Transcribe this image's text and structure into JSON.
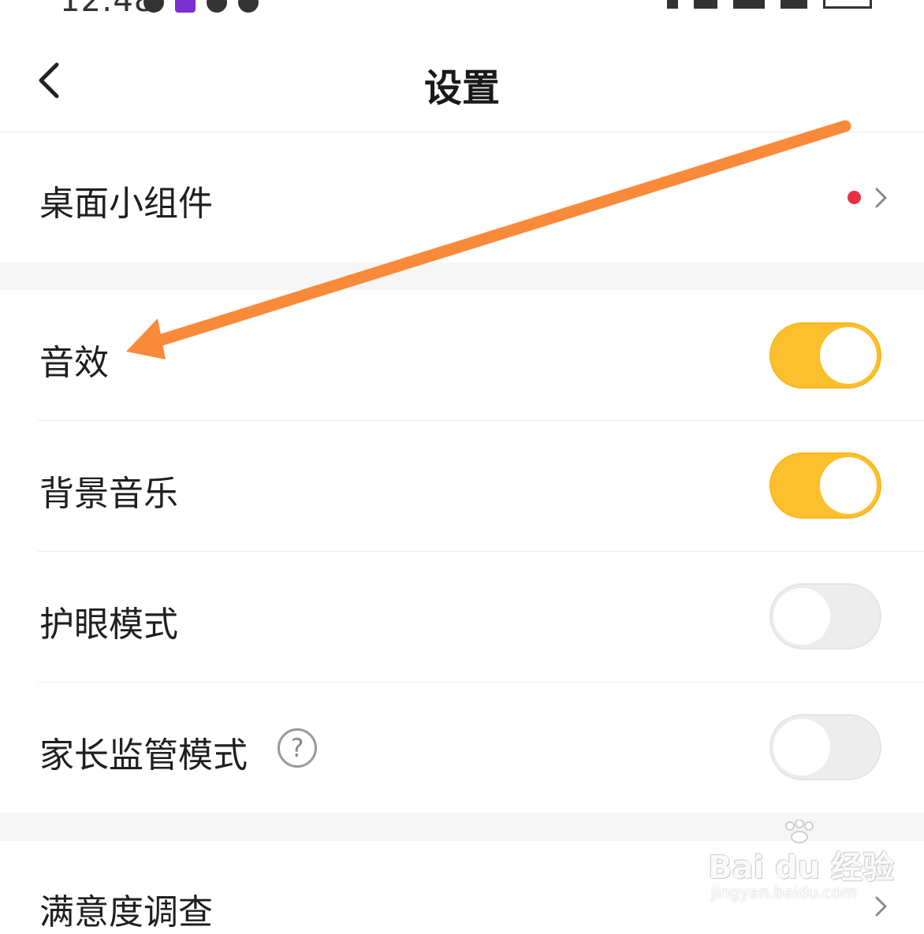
{
  "status_bar": {
    "time": "12:48"
  },
  "nav": {
    "title": "设置"
  },
  "rows": {
    "widget": {
      "label": "桌面小组件",
      "has_red_dot": true
    },
    "sound_effects": {
      "label": "音效",
      "toggle_on": true
    },
    "background_music": {
      "label": "背景音乐",
      "toggle_on": true
    },
    "eye_protection": {
      "label": "护眼模式",
      "toggle_on": false
    },
    "parental_control": {
      "label": "家长监管模式",
      "toggle_on": false,
      "help_glyph": "?"
    },
    "survey": {
      "label": "满意度调查"
    }
  },
  "watermark": {
    "brand": "Bai du 经验",
    "url": "jingyan.baidu.com"
  },
  "colors": {
    "toggle_on": "#fcc02e",
    "toggle_off": "#ededed",
    "red_dot": "#e8303f",
    "annotation_arrow": "#f98a3a"
  },
  "icons": {
    "back": "chevron-left-icon",
    "row_arrow": "chevron-right-icon",
    "help": "question-circle-icon"
  }
}
